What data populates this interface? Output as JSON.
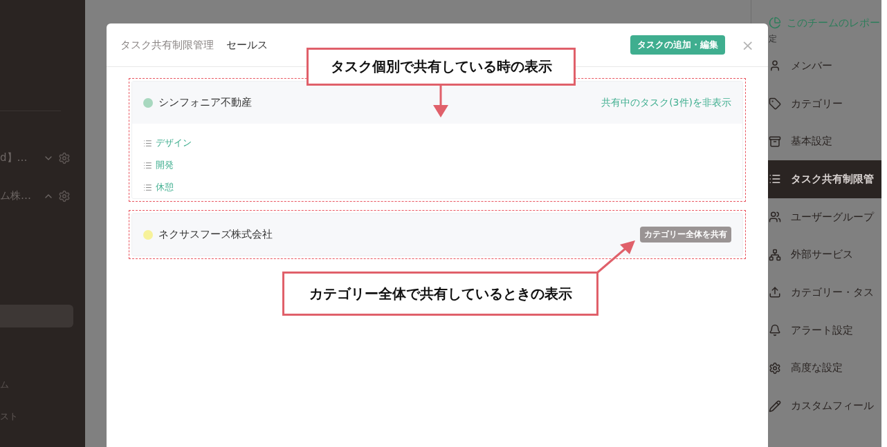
{
  "left_sidebar": {
    "items": [
      {
        "label": "d】…",
        "expanded": false
      },
      {
        "label": "ム株…",
        "expanded": true
      }
    ],
    "footer_items": [
      "ム",
      "スト"
    ]
  },
  "modal": {
    "title": "タスク共有制限管理",
    "team": "セールス",
    "add_button": "タスクの追加・編集",
    "close": "×",
    "categories": [
      {
        "kind": "individual",
        "name": "シンフォニア不動産",
        "color": "#a8d8bf",
        "toggle_link": "共有中のタスク(3件)を非表示",
        "tasks": [
          "デザイン",
          "開発",
          "休憩"
        ]
      },
      {
        "kind": "whole",
        "name": "ネクサスフーズ株式会社",
        "color": "#f7f29a",
        "badge": "カテゴリー全体を共有"
      }
    ]
  },
  "annotations": [
    {
      "kind": "down",
      "text": "タスク個別で共有している時の表示"
    },
    {
      "kind": "up-right",
      "text": "カテゴリー全体で共有しているときの表示"
    }
  ],
  "settings_panel": {
    "report_link": "このチームのレポー",
    "section_label": "定",
    "items": [
      {
        "label": "メンバー",
        "selected": false
      },
      {
        "label": "カテゴリー",
        "selected": false
      },
      {
        "label": "基本設定",
        "selected": false
      },
      {
        "label": "タスク共有制限管",
        "selected": true
      },
      {
        "label": "ユーザーグループ",
        "selected": false
      },
      {
        "label": "外部サービス",
        "selected": false
      },
      {
        "label": "カテゴリー・タス",
        "selected": false
      },
      {
        "label": "アラート設定",
        "selected": false
      },
      {
        "label": "高度な設定",
        "selected": false
      },
      {
        "label": "カスタムフィール",
        "selected": false
      }
    ]
  }
}
